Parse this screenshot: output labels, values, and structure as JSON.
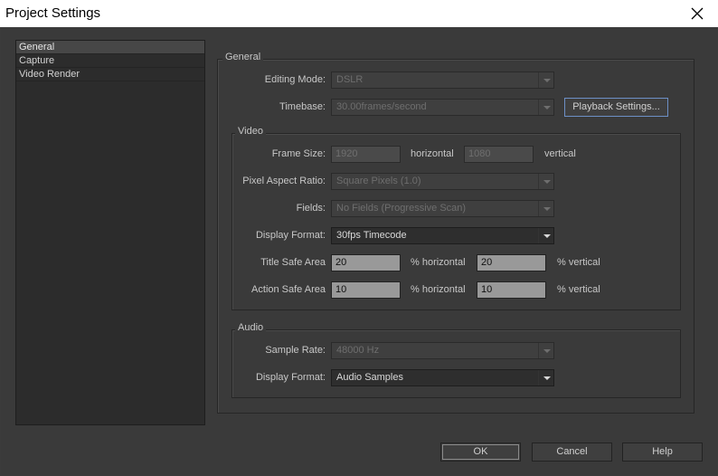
{
  "window": {
    "title": "Project Settings"
  },
  "sidebar": {
    "items": [
      {
        "label": "General",
        "selected": true
      },
      {
        "label": "Capture"
      },
      {
        "label": "Video Render"
      }
    ]
  },
  "general": {
    "group_label": "General",
    "editing_mode": {
      "label": "Editing Mode:",
      "value": "DSLR"
    },
    "timebase": {
      "label": "Timebase:",
      "value": "30.00frames/second"
    },
    "playback_button": "Playback Settings..."
  },
  "video": {
    "group_label": "Video",
    "frame_size": {
      "label": "Frame Size:",
      "width": "1920",
      "width_unit": "horizontal",
      "height": "1080",
      "height_unit": "vertical"
    },
    "pixel_aspect": {
      "label": "Pixel Aspect Ratio:",
      "value": "Square Pixels (1.0)"
    },
    "fields": {
      "label": "Fields:",
      "value": "No Fields (Progressive Scan)"
    },
    "display_format": {
      "label": "Display Format:",
      "value": "30fps Timecode"
    },
    "title_safe": {
      "label": "Title Safe Area",
      "h": "20",
      "h_unit": "% horizontal",
      "v": "20",
      "v_unit": "% vertical"
    },
    "action_safe": {
      "label": "Action Safe Area",
      "h": "10",
      "h_unit": "% horizontal",
      "v": "10",
      "v_unit": "% vertical"
    }
  },
  "audio": {
    "group_label": "Audio",
    "sample_rate": {
      "label": "Sample Rate:",
      "value": "48000 Hz"
    },
    "display_format": {
      "label": "Display Format:",
      "value": "Audio Samples"
    }
  },
  "buttons": {
    "ok": "OK",
    "cancel": "Cancel",
    "help": "Help"
  }
}
